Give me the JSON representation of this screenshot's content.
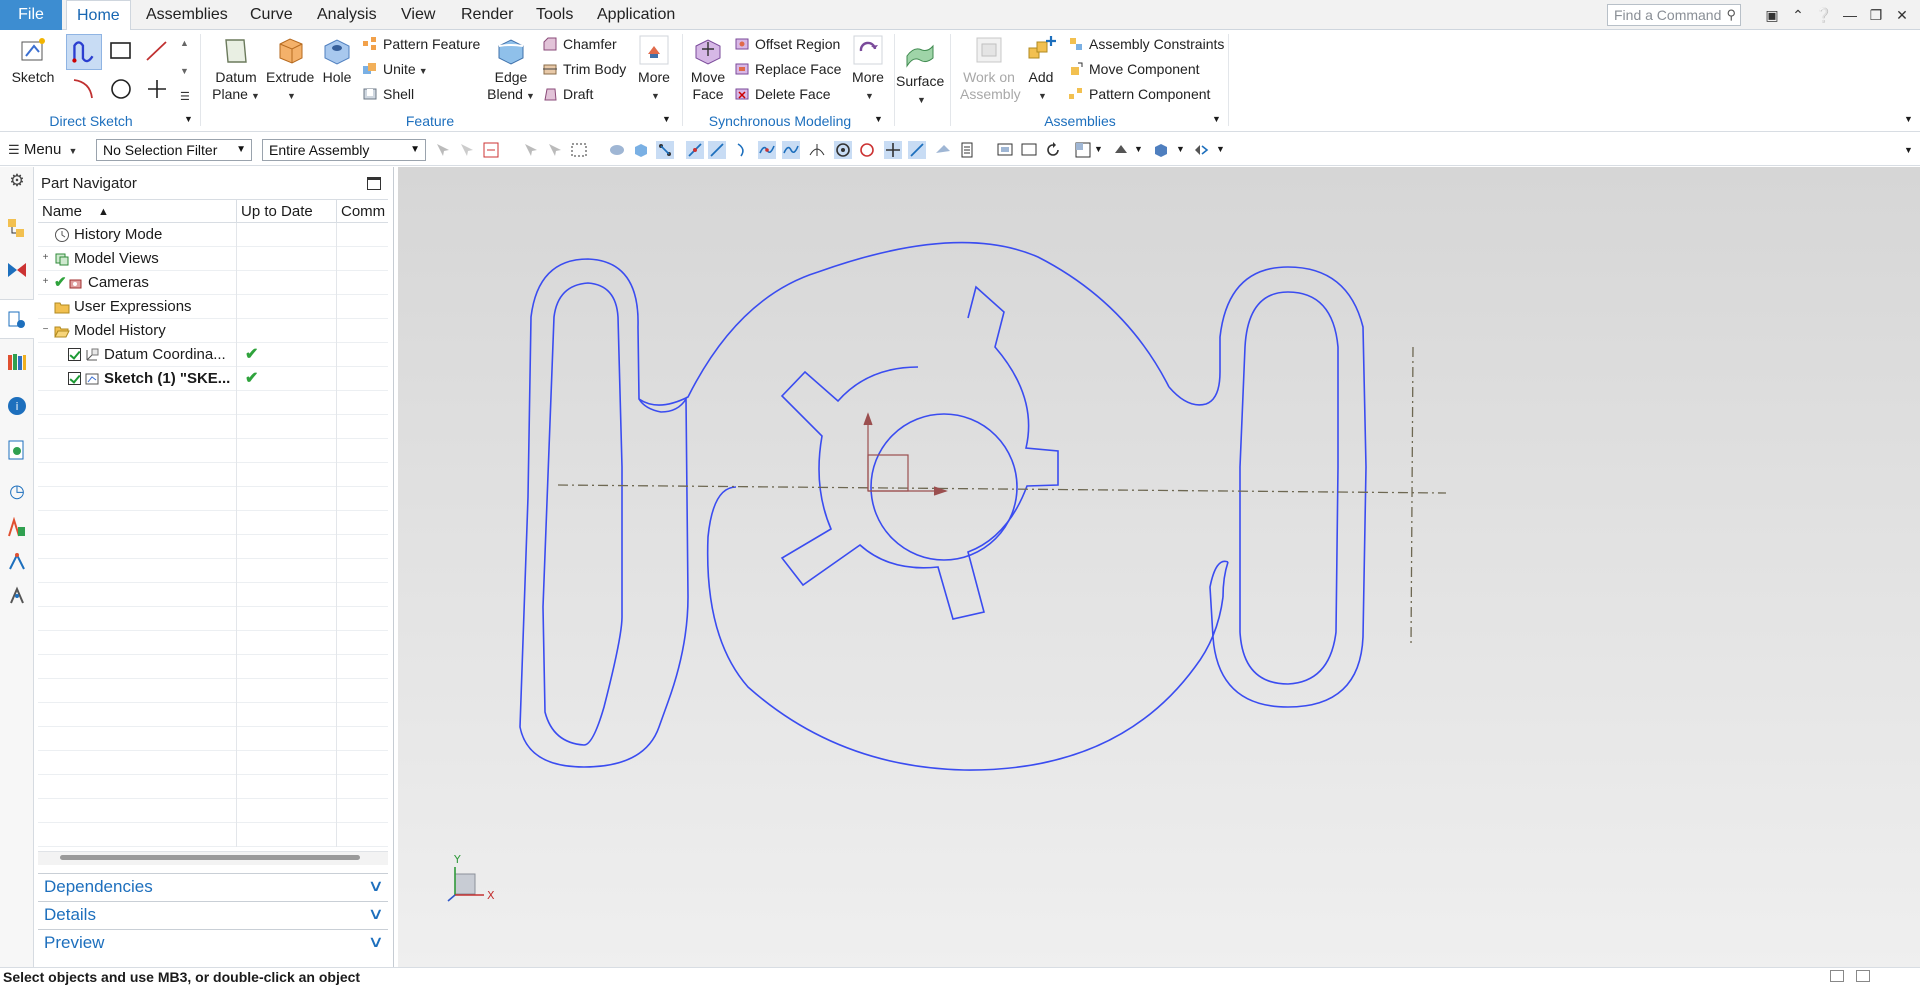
{
  "tabs": [
    "File",
    "Home",
    "Assemblies",
    "Curve",
    "Analysis",
    "View",
    "Render",
    "Tools",
    "Application"
  ],
  "active_tab": "Home",
  "search": {
    "placeholder": "Find a Command"
  },
  "ribbon": {
    "direct_sketch": {
      "label": "Direct Sketch",
      "sketch_button": "Sketch"
    },
    "feature": {
      "label": "Feature",
      "datum_plane": [
        "Datum",
        "Plane"
      ],
      "extrude": "Extrude",
      "hole": "Hole",
      "pattern_feature": "Pattern Feature",
      "unite": "Unite",
      "shell": "Shell",
      "edge_blend": [
        "Edge",
        "Blend"
      ],
      "chamfer": "Chamfer",
      "trim_body": "Trim Body",
      "draft": "Draft",
      "more": "More"
    },
    "sync_modeling": {
      "label": "Synchronous Modeling",
      "move_face": [
        "Move",
        "Face"
      ],
      "offset_region": "Offset Region",
      "replace_face": "Replace Face",
      "delete_face": "Delete Face",
      "more": "More"
    },
    "surface": {
      "label": "Surface"
    },
    "assemblies": {
      "label": "Assemblies",
      "work_on_assembly": [
        "Work on",
        "Assembly"
      ],
      "add": "Add",
      "assembly_constraints": "Assembly Constraints",
      "move_component": "Move Component",
      "pattern_component": "Pattern Component"
    }
  },
  "toolbar": {
    "menu": "Menu",
    "selection_filter": "No Selection Filter",
    "scope": "Entire Assembly"
  },
  "navigator": {
    "title": "Part Navigator",
    "columns": [
      "Name",
      "Up to Date",
      "Comm"
    ],
    "rows": [
      {
        "label": "History Mode",
        "icon": "clock-icon",
        "expander": "",
        "bold": false,
        "up_to_date": false
      },
      {
        "label": "Model Views",
        "icon": "model-views-icon",
        "expander": "+",
        "bold": false,
        "up_to_date": false
      },
      {
        "label": "Cameras",
        "icon": "camera-icon",
        "expander": "+",
        "bold": false,
        "up_to_date": false
      },
      {
        "label": "User Expressions",
        "icon": "folder-icon",
        "expander": "",
        "bold": false,
        "up_to_date": false
      },
      {
        "label": "Model History",
        "icon": "folder-open-icon",
        "expander": "−",
        "bold": false,
        "up_to_date": false
      },
      {
        "label": "Datum Coordina...",
        "icon": "datum-csys-icon",
        "expander": "",
        "bold": false,
        "up_to_date": true
      },
      {
        "label": "Sketch (1) \"SKE...",
        "icon": "sketch-feature-icon",
        "expander": "",
        "bold": true,
        "up_to_date": true
      }
    ],
    "sections": [
      "Dependencies",
      "Details",
      "Preview"
    ]
  },
  "status": "Select objects and use MB3, or double-click an object",
  "colors": {
    "accent": "#3d8dd1",
    "ribbon_label": "#1d6fbd",
    "sketch_curve": "#3a4cf0",
    "centerline": "#6e6852",
    "csys": "#9b4f4f"
  },
  "axes": {
    "x": "X",
    "y": "Y"
  }
}
